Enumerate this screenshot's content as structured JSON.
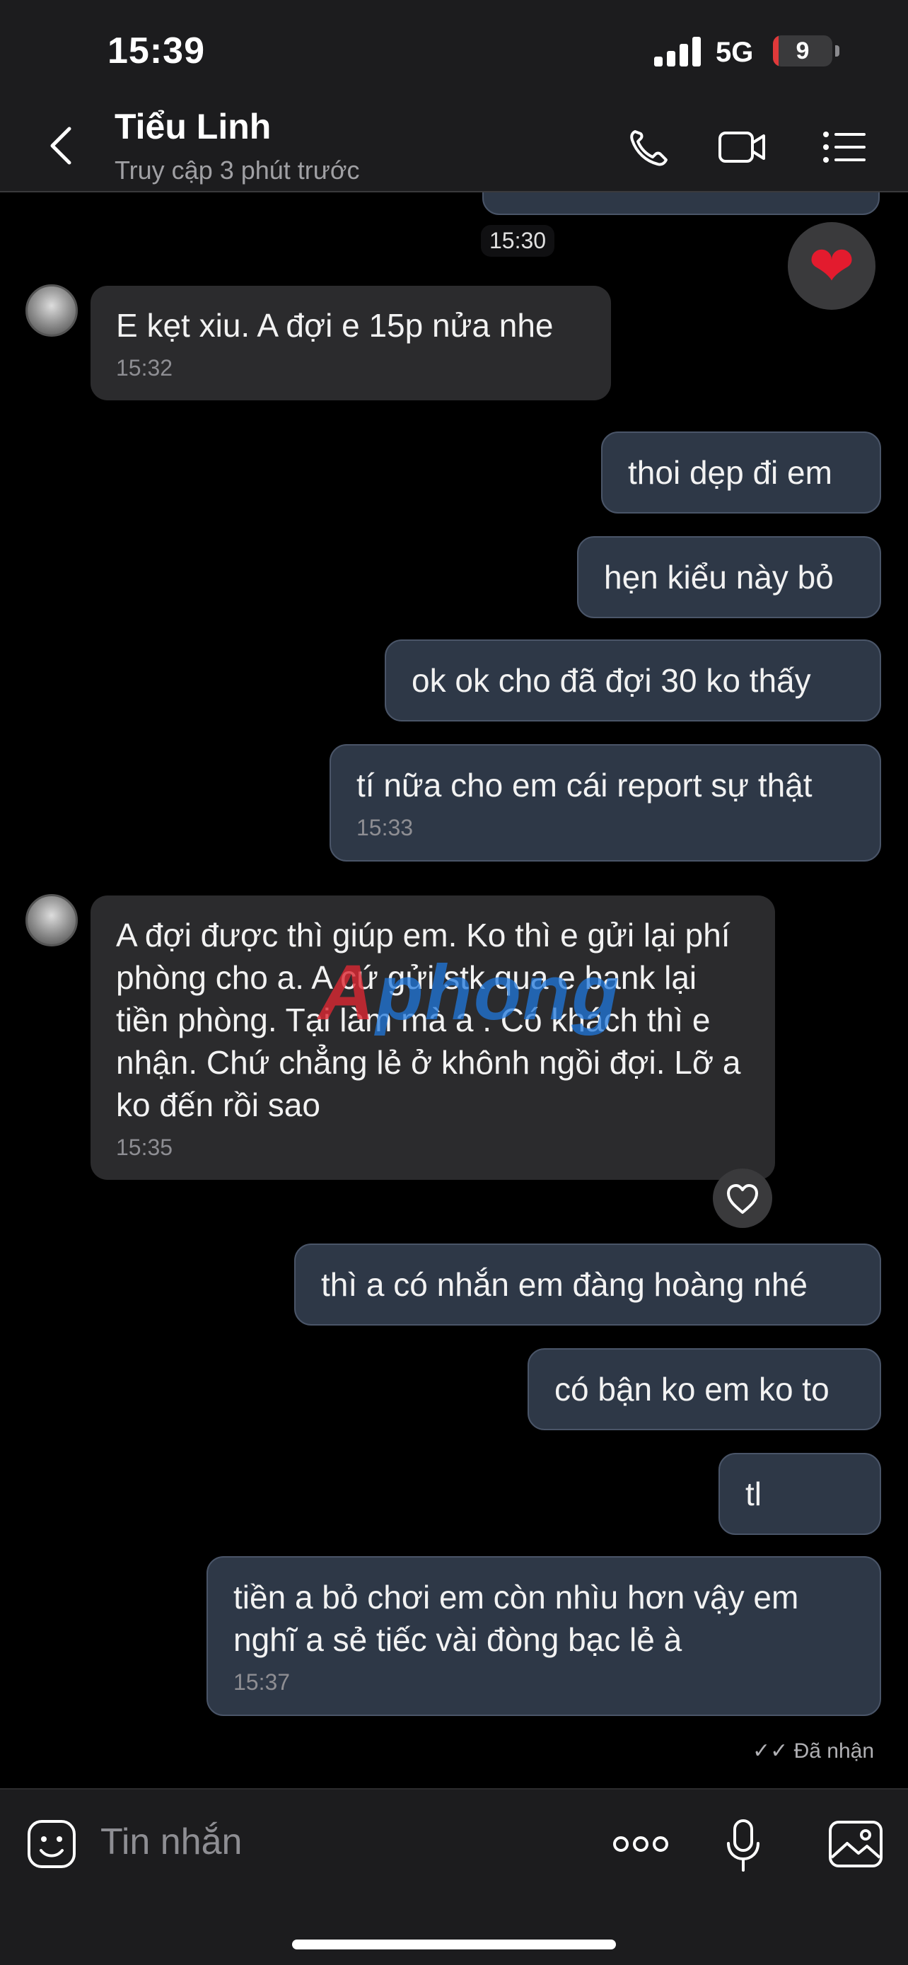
{
  "status_bar": {
    "time": "15:39",
    "network": "5G",
    "battery": "9",
    "battery_level": 0.09,
    "battery_color": "#e0393a"
  },
  "header": {
    "contact_name": "Tiểu Linh",
    "last_seen": "Truy cập 3 phút trước",
    "icons": [
      "back-icon",
      "phone-icon",
      "video-icon",
      "menu-icon"
    ]
  },
  "chat": {
    "time_pill": "15:30",
    "reaction": "❤",
    "messages": [
      {
        "direction": "in",
        "text": "E kẹt xiu. A đợi e 15p nửa nhe",
        "time": "15:32"
      },
      {
        "direction": "out",
        "text": "thoi dẹp đi em",
        "time": ""
      },
      {
        "direction": "out",
        "text": "hẹn kiểu này bỏ",
        "time": ""
      },
      {
        "direction": "out",
        "text": "ok ok cho đã đợi 30 ko thấy",
        "time": ""
      },
      {
        "direction": "out",
        "text": "tí nữa cho em cái report sự thật",
        "time": "15:33"
      },
      {
        "direction": "in",
        "text": "A đợi được thì giúp em. Ko thì e gửi lại phí phòng cho a. A cứ gửi stk qua e bank lại tiền phòng. Tại làm mà a  . Có khách thì e nhận. Chứ chẳng lẻ ở khônh ngồi đợi. Lỡ a ko đến rồi sao",
        "time": "15:35"
      },
      {
        "direction": "out",
        "text": "thì a có nhắn em đàng hoàng nhé",
        "time": ""
      },
      {
        "direction": "out",
        "text": "có bận ko em ko to",
        "time": ""
      },
      {
        "direction": "out",
        "text": "tl",
        "time": ""
      },
      {
        "direction": "out",
        "text": "tiền a bỏ chơi em còn nhìu hơn vậy em nghĩ a sẻ tiếc vài đòng bạc lẻ à",
        "time": "15:37"
      }
    ],
    "delivery_status": "✓✓ Đã nhận",
    "watermark": "phong"
  },
  "input_bar": {
    "placeholder": "Tin nhắn",
    "icons": [
      "sticker-icon",
      "more-icon",
      "mic-icon",
      "gallery-icon"
    ]
  }
}
